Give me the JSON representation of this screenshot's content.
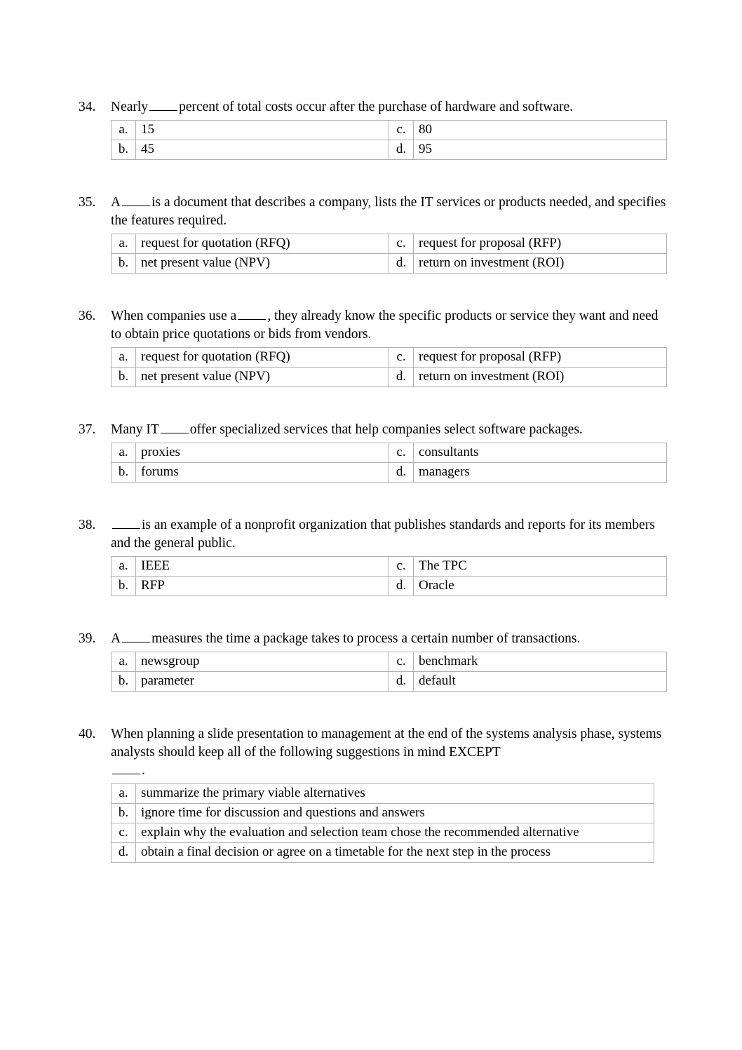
{
  "document": {
    "type": "multiple-choice-quiz-page",
    "questions": [
      {
        "number": "34.",
        "text_before": "Nearly",
        "has_blank": true,
        "text_after": "percent of total costs occur after the purchase of hardware and software.",
        "layout": "two-column",
        "options": [
          {
            "letter": "a.",
            "value": "15"
          },
          {
            "letter": "b.",
            "value": "45"
          },
          {
            "letter": "c.",
            "value": "80"
          },
          {
            "letter": "d.",
            "value": "95"
          }
        ]
      },
      {
        "number": "35.",
        "text_before": "A",
        "has_blank": true,
        "text_after": "is a document that describes a company, lists the IT services or products needed, and specifies the features required.",
        "layout": "two-column",
        "options": [
          {
            "letter": "a.",
            "value": "request for quotation (RFQ)"
          },
          {
            "letter": "b.",
            "value": "net present value (NPV)"
          },
          {
            "letter": "c.",
            "value": "request for proposal (RFP)"
          },
          {
            "letter": "d.",
            "value": "return on investment (ROI)"
          }
        ]
      },
      {
        "number": "36.",
        "text_before": "When companies use a",
        "has_blank": true,
        "text_after": ", they already know the specific products or service they want and need to obtain price quotations or bids from vendors.",
        "layout": "two-column",
        "options": [
          {
            "letter": "a.",
            "value": "request for quotation (RFQ)"
          },
          {
            "letter": "b.",
            "value": "net present value (NPV)"
          },
          {
            "letter": "c.",
            "value": "request for proposal (RFP)"
          },
          {
            "letter": "d.",
            "value": "return on investment (ROI)"
          }
        ]
      },
      {
        "number": "37.",
        "text_before": "Many IT",
        "has_blank": true,
        "text_after": "offer specialized services that help companies select software packages.",
        "layout": "two-column",
        "options": [
          {
            "letter": "a.",
            "value": "proxies"
          },
          {
            "letter": "b.",
            "value": "forums"
          },
          {
            "letter": "c.",
            "value": "consultants"
          },
          {
            "letter": "d.",
            "value": "managers"
          }
        ]
      },
      {
        "number": "38.",
        "text_before": "",
        "has_blank": true,
        "text_after": "is an example of a nonprofit organization that publishes standards and reports for its members and the general public.",
        "layout": "two-column",
        "options": [
          {
            "letter": "a.",
            "value": "IEEE"
          },
          {
            "letter": "b.",
            "value": "RFP"
          },
          {
            "letter": "c.",
            "value": "The TPC"
          },
          {
            "letter": "d.",
            "value": "Oracle"
          }
        ]
      },
      {
        "number": "39.",
        "text_before": "A",
        "has_blank": true,
        "text_after": "measures the time a package takes to process a certain number of transactions.",
        "layout": "two-column",
        "options": [
          {
            "letter": "a.",
            "value": "newsgroup"
          },
          {
            "letter": "b.",
            "value": "parameter"
          },
          {
            "letter": "c.",
            "value": "benchmark"
          },
          {
            "letter": "d.",
            "value": "default"
          }
        ]
      },
      {
        "number": "40.",
        "text_before": "When planning a slide presentation to management at the end of the systems analysis phase, systems analysts should keep all of the following suggestions in mind EXCEPT",
        "has_blank": false,
        "text_after": "",
        "trailing_blank_text": ".",
        "layout": "single-column",
        "options": [
          {
            "letter": "a.",
            "value": "summarize the primary viable alternatives"
          },
          {
            "letter": "b.",
            "value": "ignore time for discussion and questions and answers"
          },
          {
            "letter": "c.",
            "value": "explain why the evaluation and selection team chose the recommended alternative"
          },
          {
            "letter": "d.",
            "value": "obtain a final decision or agree on a timetable for the next step in the process"
          }
        ]
      }
    ]
  }
}
